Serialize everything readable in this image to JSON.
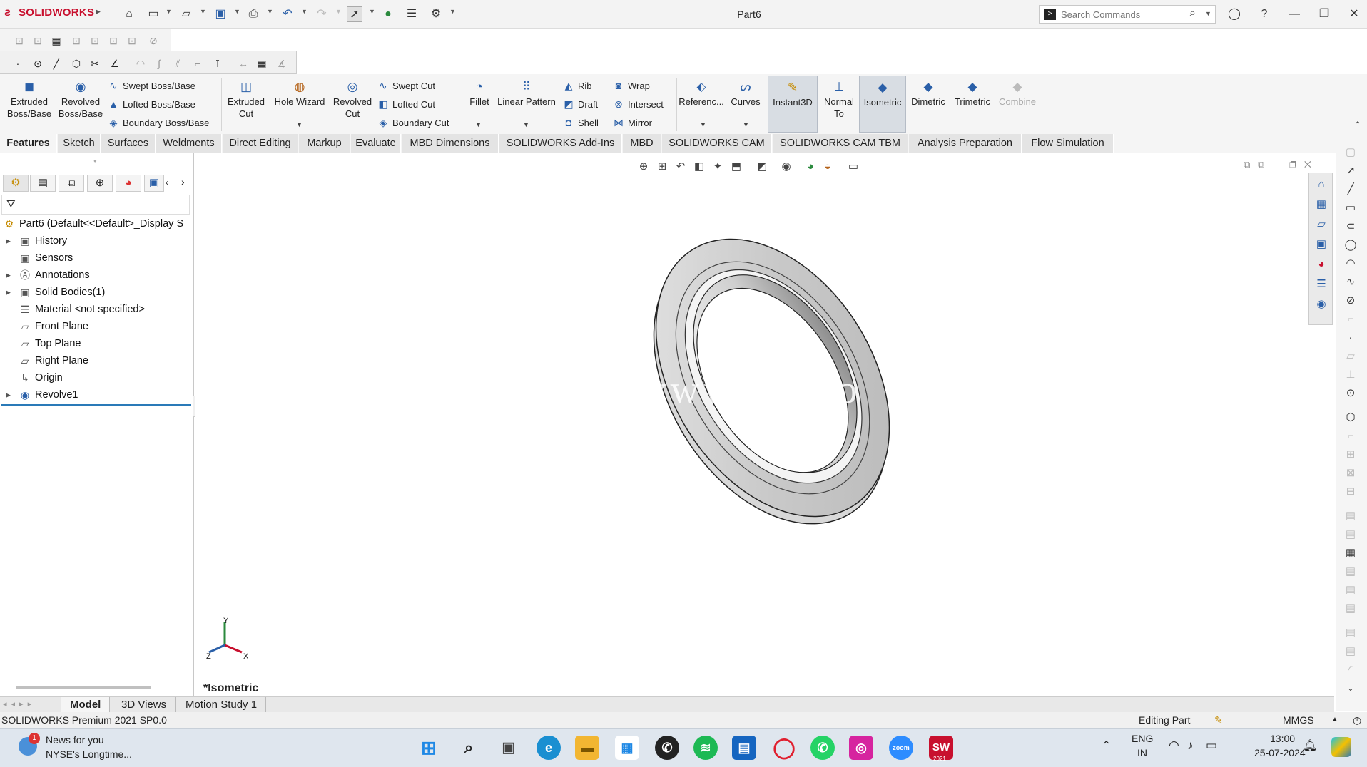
{
  "app": {
    "logo": "SOLIDWORKS",
    "doc_title": "Part6"
  },
  "search": {
    "placeholder": "Search Commands"
  },
  "commands": {
    "extruded_boss": "Extruded\nBoss/Base",
    "revolved_boss": "Revolved\nBoss/Base",
    "swept_boss": "Swept Boss/Base",
    "lofted_boss": "Lofted Boss/Base",
    "boundary_boss": "Boundary Boss/Base",
    "extruded_cut": "Extruded\nCut",
    "hole_wizard": "Hole Wizard",
    "revolved_cut": "Revolved\nCut",
    "swept_cut": "Swept Cut",
    "lofted_cut": "Lofted Cut",
    "boundary_cut": "Boundary Cut",
    "fillet": "Fillet",
    "linear_pattern": "Linear Pattern",
    "rib": "Rib",
    "draft": "Draft",
    "shell": "Shell",
    "wrap": "Wrap",
    "intersect": "Intersect",
    "mirror": "Mirror",
    "reference": "Referenc...",
    "curves": "Curves",
    "instant3d": "Instant3D",
    "normal_to": "Normal\nTo",
    "isometric": "Isometric",
    "dimetric": "Dimetric",
    "trimetric": "Trimetric",
    "combine": "Combine"
  },
  "tabs": [
    "Features",
    "Sketch",
    "Surfaces",
    "Weldments",
    "Direct Editing",
    "Markup",
    "Evaluate",
    "MBD Dimensions",
    "SOLIDWORKS Add-Ins",
    "MBD",
    "SOLIDWORKS CAM",
    "SOLIDWORKS CAM TBM",
    "Analysis Preparation",
    "Flow Simulation"
  ],
  "tree": {
    "root": "Part6  (Default<<Default>_Display S",
    "items": [
      {
        "label": "History",
        "expandable": true
      },
      {
        "label": "Sensors",
        "expandable": false
      },
      {
        "label": "Annotations",
        "expandable": true
      },
      {
        "label": "Solid Bodies(1)",
        "expandable": true
      },
      {
        "label": "Material <not specified>",
        "expandable": false
      },
      {
        "label": "Front Plane",
        "expandable": false
      },
      {
        "label": "Top Plane",
        "expandable": false
      },
      {
        "label": "Right Plane",
        "expandable": false
      },
      {
        "label": "Origin",
        "expandable": false
      },
      {
        "label": "Revolve1",
        "expandable": true
      }
    ]
  },
  "viewport": {
    "view_label": "*Isometric",
    "watermark": "www.3 . co",
    "triad": {
      "x": "X",
      "y": "Y",
      "z": "Z"
    }
  },
  "bottom_tabs": [
    "Model",
    "3D Views",
    "Motion Study 1"
  ],
  "status": {
    "version": "SOLIDWORKS Premium 2021 SP0.0",
    "mode": "Editing Part",
    "units": "MMGS"
  },
  "taskbar": {
    "news_title": "News for you",
    "news_sub": "NYSE's Longtime...",
    "news_badge": "1",
    "lang1": "ENG",
    "lang2": "IN",
    "time": "13:00",
    "date": "25-07-2024",
    "sw_badge": "2021"
  },
  "colors": {
    "accent_blue": "#2a5fa8",
    "brand_red": "#c8102e",
    "part_gray": "#c9c9c9"
  }
}
